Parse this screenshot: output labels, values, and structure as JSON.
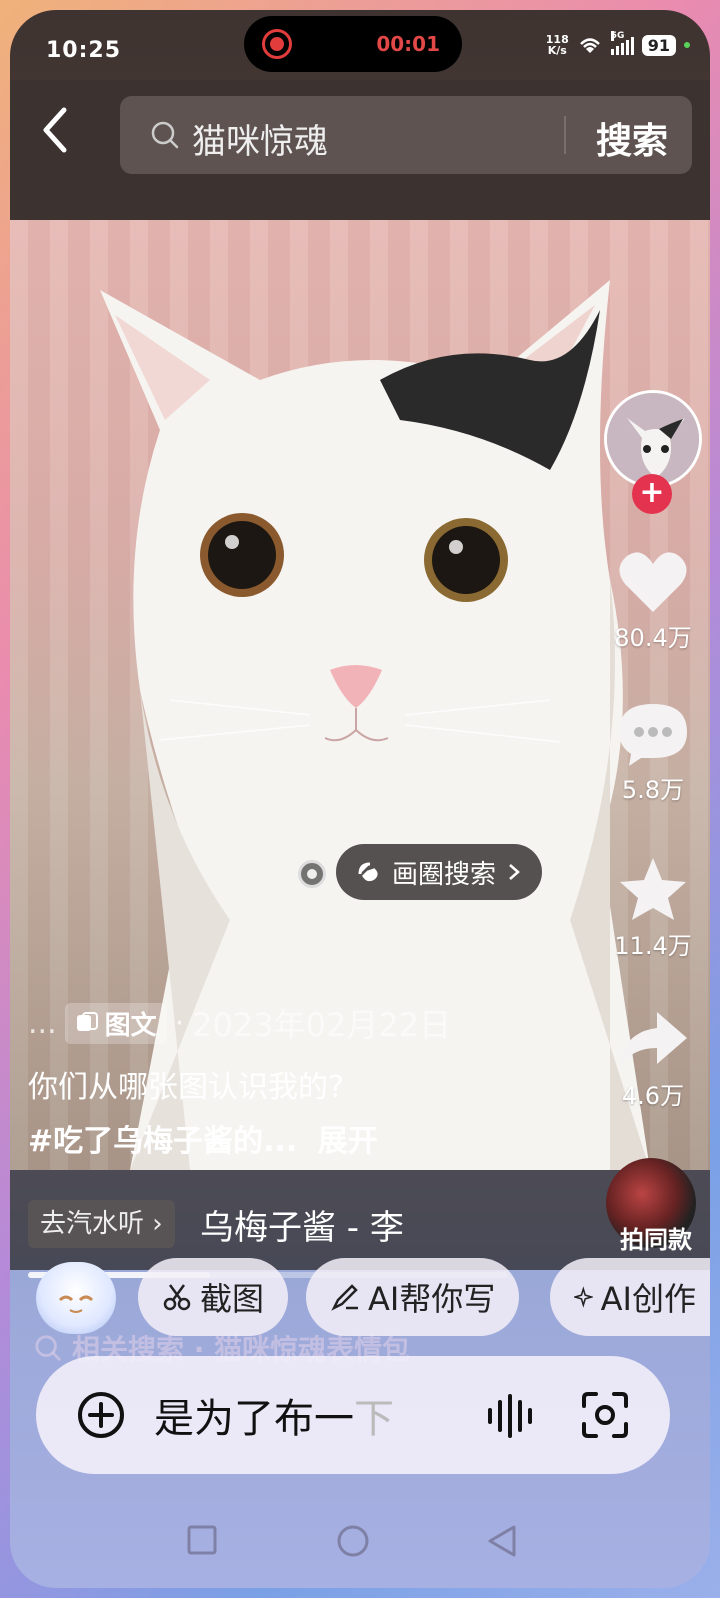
{
  "status": {
    "time": "10:25",
    "recording_time": "00:01",
    "net_speed_value": "118",
    "net_speed_unit": "K/s",
    "network": "5G",
    "battery": "91"
  },
  "header": {
    "search_query": "猫咪惊魂",
    "search_button": "搜索"
  },
  "video": {
    "circle_search": "画圈搜索"
  },
  "actions": {
    "likes": "80.4万",
    "comments": "5.8万",
    "favorites": "11.4万",
    "shares": "4.6万"
  },
  "post": {
    "more": "...",
    "type_tag": "图文",
    "separator": "·",
    "date": "2023年02月22日",
    "caption": "你们从哪张图认识我的?",
    "hashtag": "#吃了乌梅子酱的...",
    "expand": "展开"
  },
  "music": {
    "soda_label": "去汽水听",
    "song": "乌梅子酱 - 李",
    "shoot_same": "拍同款",
    "progress": 0.38
  },
  "ai_chips": {
    "screenshot": "截图",
    "ai_write": "AI帮你写",
    "ai_create": "AI创作"
  },
  "related": {
    "text": "相关搜索 · 猫咪惊魂表情包"
  },
  "input": {
    "typed": "是为了布一",
    "faded": "下"
  },
  "colors": {
    "accent_red": "#e4334f",
    "header_bg": "#3c3230"
  }
}
